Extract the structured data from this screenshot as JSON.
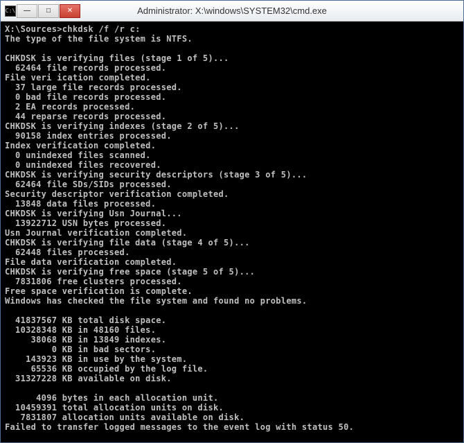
{
  "window": {
    "title": "Administrator: X:\\windows\\SYSTEM32\\cmd.exe",
    "icon_label": "C:\\"
  },
  "terminal": {
    "prompt": "X:\\Sources>",
    "command": "chkdsk /f /r c:",
    "lines": [
      "The type of the file system is NTFS.",
      "",
      "CHKDSK is verifying files (stage 1 of 5)...",
      "  62464 file records processed.",
      "File veri ication completed.",
      "  37 large file records processed.",
      "  0 bad file records processed.",
      "  2 EA records processed.",
      "  44 reparse records processed.",
      "CHKDSK is verifying indexes (stage 2 of 5)...",
      "  90158 index entries processed.",
      "Index verification completed.",
      "  0 unindexed files scanned.",
      "  0 unindexed files recovered.",
      "CHKDSK is verifying security descriptors (stage 3 of 5)...",
      "  62464 file SDs/SIDs processed.",
      "Security descriptor verification completed.",
      "  13848 data files processed.",
      "CHKDSK is verifying Usn Journal...",
      "  13922712 USN bytes processed.",
      "Usn Journal verification completed.",
      "CHKDSK is verifying file data (stage 4 of 5)...",
      "  62448 files processed.",
      "File data verification completed.",
      "CHKDSK is verifying free space (stage 5 of 5)...",
      "  7831806 free clusters processed.",
      "Free space verification is complete.",
      "Windows has checked the file system and found no problems.",
      "",
      "  41837567 KB total disk space.",
      "  10328348 KB in 48160 files.",
      "     38068 KB in 13849 indexes.",
      "         0 KB in bad sectors.",
      "    143923 KB in use by the system.",
      "     65536 KB occupied by the log file.",
      "  31327228 KB available on disk.",
      "",
      "      4096 bytes in each allocation unit.",
      "  10459391 total allocation units on disk.",
      "   7831807 allocation units available on disk.",
      "Failed to transfer logged messages to the event log with status 50."
    ]
  },
  "buttons": {
    "minimize": "—",
    "maximize": "□",
    "close": "✕"
  }
}
